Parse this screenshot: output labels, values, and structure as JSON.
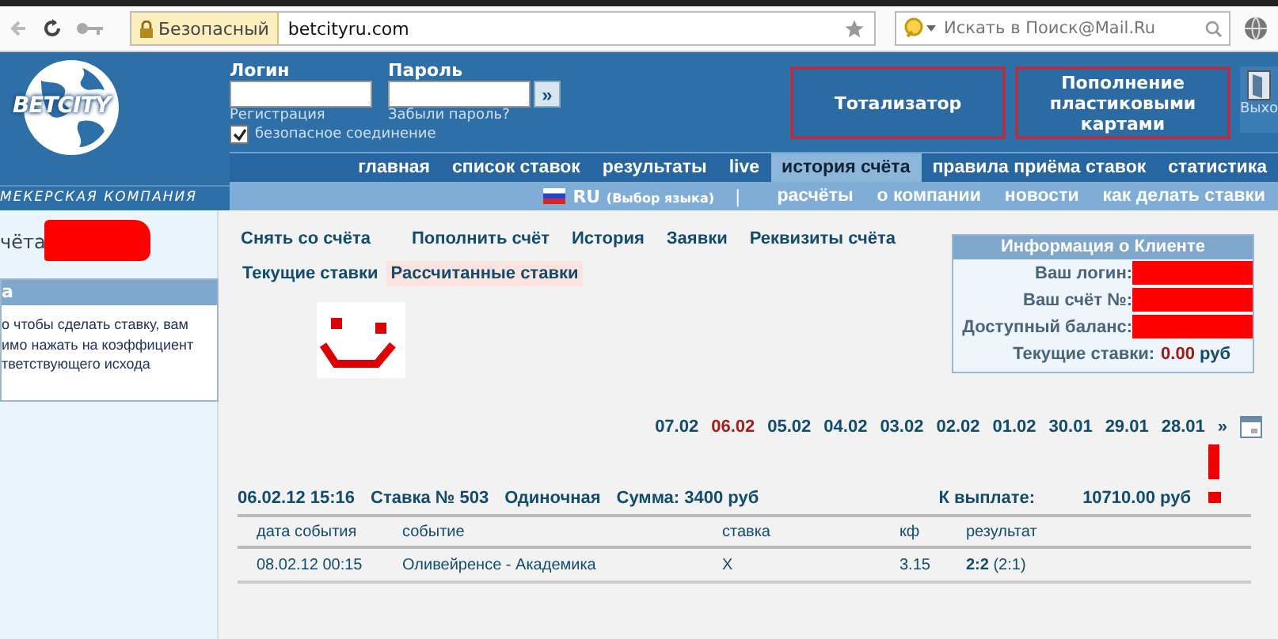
{
  "browser": {
    "security_label": "Безопасный",
    "url": "betcityru.com",
    "search_placeholder": "Искать в Поиск@Mail.Ru"
  },
  "header": {
    "logo_text": "BETCITY",
    "tagline": "МЕКЕРСКАЯ КОМПАНИЯ",
    "login_label": "Логин",
    "password_label": "Пароль",
    "submit": "»",
    "register_link": "Регистрация",
    "forgot_link": "Забыли пароль?",
    "secure": {
      "label": "безопасное соединение",
      "checked": true
    },
    "buttons": [
      "Тотализатор",
      "Пополнение пластиковыми картами"
    ],
    "exit_label": "Выхо"
  },
  "nav_main": [
    {
      "label": "главная",
      "selected": false
    },
    {
      "label": "список ставок",
      "selected": false
    },
    {
      "label": "результаты",
      "selected": false
    },
    {
      "label": "live",
      "selected": false
    },
    {
      "label": "история счёта",
      "selected": true
    },
    {
      "label": "правила приёма ставок",
      "selected": false
    },
    {
      "label": "статистика",
      "selected": false
    }
  ],
  "nav_sub": {
    "language": "RU",
    "language_hint": "(Выбор языка)",
    "separator": "|",
    "items": [
      "расчёты",
      "о компании",
      "новости",
      "как делать ставки"
    ]
  },
  "sidebar": {
    "title": "чёта",
    "box_title": "а",
    "box_text": [
      "о чтобы сделать ставку, вам",
      "имо нажать на коэффициент",
      "тветствующего исхода"
    ]
  },
  "account_links": [
    "Снять со счёта",
    "Пополнить счёт",
    "История",
    "Заявки",
    "Реквизиты счёта"
  ],
  "bet_tabs": [
    {
      "label": "Текущие ставки",
      "selected": false
    },
    {
      "label": "Рассчитанные ставки",
      "selected": true
    }
  ],
  "client_info": {
    "title": "Информация о Клиенте",
    "rows": [
      {
        "label": "Ваш логин:",
        "redacted": true
      },
      {
        "label": "Ваш счёт №:",
        "redacted": true
      },
      {
        "label": "Доступный баланс:",
        "redacted": true
      },
      {
        "label": "Текущие ставки:",
        "value": "0.00",
        "unit": "руб",
        "redacted": false
      }
    ]
  },
  "dates": [
    {
      "label": "07.02",
      "selected": false
    },
    {
      "label": "06.02",
      "selected": true
    },
    {
      "label": "05.02",
      "selected": false
    },
    {
      "label": "04.02",
      "selected": false
    },
    {
      "label": "03.02",
      "selected": false
    },
    {
      "label": "02.02",
      "selected": false
    },
    {
      "label": "01.02",
      "selected": false
    },
    {
      "label": "30.01",
      "selected": false
    },
    {
      "label": "29.01",
      "selected": false
    },
    {
      "label": "28.01",
      "selected": false
    }
  ],
  "dates_more": "»",
  "bet": {
    "datetime": "06.02.12 15:16",
    "number": "Ставка № 503",
    "type": "Одиночная",
    "sum": "Сумма: 3400 руб",
    "payout_label": "К выплате:",
    "payout": "10710.00 руб"
  },
  "table": {
    "columns": [
      "дата события",
      "событие",
      "ставка",
      "кф",
      "результат"
    ],
    "rows": [
      [
        "08.02.12 00:15",
        "Оливейренсе - Академика",
        "X",
        "3.15",
        "**2:2** (2:1)"
      ]
    ]
  }
}
